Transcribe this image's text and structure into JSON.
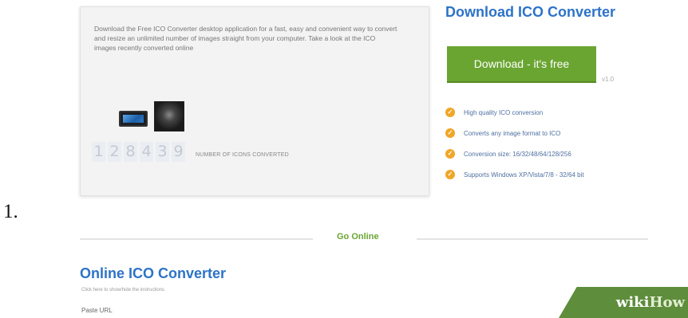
{
  "step": {
    "number": "1."
  },
  "info_box": {
    "description": "Download the Free ICO Converter desktop application for a fast, easy and convenient way to convert and resize an unlimited number of images straight from your computer. Take a look at the ICO images recently converted online",
    "counter_digits": [
      "1",
      "2",
      "8",
      "4",
      "3",
      "9"
    ],
    "counter_label": "NUMBER OF ICONS CONVERTED"
  },
  "download": {
    "title": "Download ICO Converter",
    "button_label": "Download - it's free",
    "version": "v1.0",
    "features": [
      "High quality ICO conversion",
      "Converts any image format to ICO",
      "Conversion size: 16/32/48/64/128/256",
      "Supports Windows XP/Vista/7/8 - 32/64 bit"
    ]
  },
  "divider": {
    "label": "Go Online"
  },
  "online": {
    "title": "Online ICO Converter",
    "instructions_link": "Click here to show/hide the instructions",
    "paste_url_label": "Paste URL"
  },
  "watermark": {
    "wiki": "wiki",
    "how": "How"
  },
  "colors": {
    "accent_blue": "#2d73c7",
    "accent_green": "#6aa532",
    "check_orange": "#f0a627"
  }
}
